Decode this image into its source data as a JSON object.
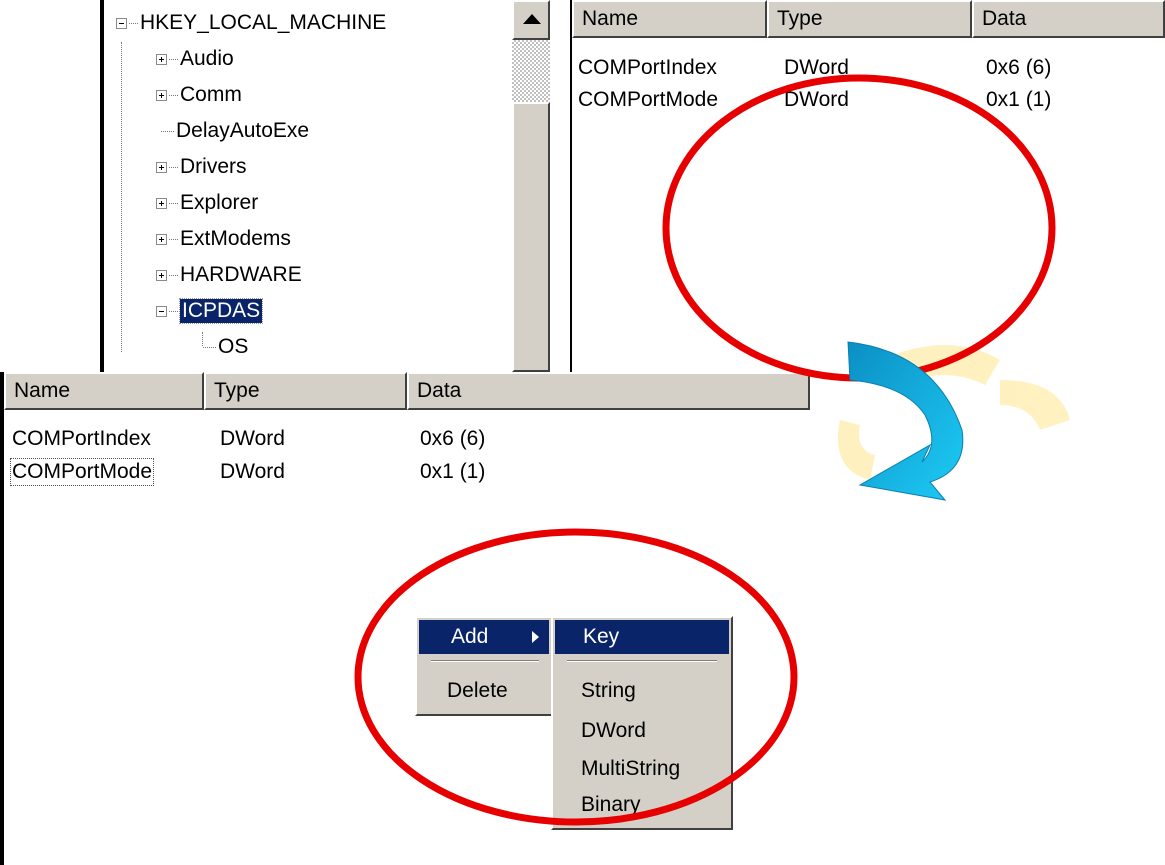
{
  "tree": {
    "root": "HKEY_LOCAL_MACHINE",
    "items": [
      {
        "label": "Audio",
        "expander": "plus"
      },
      {
        "label": "Comm",
        "expander": "plus"
      },
      {
        "label": "DelayAutoExe",
        "expander": "none"
      },
      {
        "label": "Drivers",
        "expander": "plus"
      },
      {
        "label": "Explorer",
        "expander": "plus"
      },
      {
        "label": "ExtModems",
        "expander": "plus"
      },
      {
        "label": "HARDWARE",
        "expander": "plus"
      },
      {
        "label": "ICPDAS",
        "expander": "minus",
        "selected": true
      }
    ],
    "child": "OS"
  },
  "top_list": {
    "columns": [
      "Name",
      "Type",
      "Data"
    ],
    "rows": [
      {
        "name": "COMPortIndex",
        "type": "DWord",
        "data": "0x6 (6)"
      },
      {
        "name": "COMPortMode",
        "type": "DWord",
        "data": "0x1 (1)"
      }
    ]
  },
  "bottom_list": {
    "columns": [
      "Name",
      "Type",
      "Data"
    ],
    "rows": [
      {
        "name": "COMPortIndex",
        "type": "DWord",
        "data": "0x6 (6)"
      },
      {
        "name": "COMPortMode",
        "type": "DWord",
        "data": "0x1 (1)",
        "focused": true
      }
    ]
  },
  "context_menu": {
    "add": "Add",
    "delete": "Delete"
  },
  "submenu": {
    "key": "Key",
    "items": [
      "String",
      "DWord",
      "MultiString",
      "Binary"
    ]
  },
  "colors": {
    "highlight": "#0a246a",
    "annotation_circle": "#e60000",
    "arrow": "#1ab4e6",
    "face": "#d4d0c8"
  }
}
